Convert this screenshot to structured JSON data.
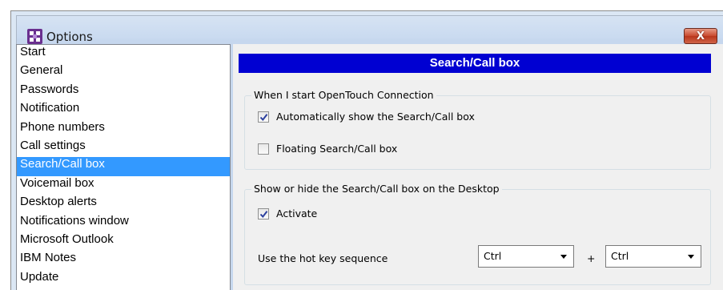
{
  "window": {
    "title": "Options",
    "close_label": "X"
  },
  "nav": {
    "selected": "Search/Call box",
    "items": [
      "Start",
      "General",
      "Passwords",
      "Notification",
      "Phone numbers",
      "Call settings",
      "Search/Call box",
      "Voicemail box",
      "Desktop alerts",
      "Notifications window",
      "Microsoft Outlook",
      "IBM Notes",
      "Update"
    ]
  },
  "panel": {
    "header": "Search/Call box",
    "group1": {
      "label": "When I start OpenTouch Connection",
      "auto_show": {
        "label": "Automatically show the Search/Call box",
        "checked": true
      },
      "floating": {
        "label": "Floating Search/Call box",
        "checked": false
      }
    },
    "group2": {
      "label": "Show or hide the Search/Call box on the Desktop",
      "activate": {
        "label": "Activate",
        "checked": true
      },
      "hotkey_label": "Use the hot key sequence",
      "key1": "Ctrl",
      "plus": "+",
      "key2": "Ctrl"
    }
  },
  "colors": {
    "header_bg": "#0000d2",
    "selection_bg": "#3399ff",
    "close_button": "#c8482e"
  }
}
